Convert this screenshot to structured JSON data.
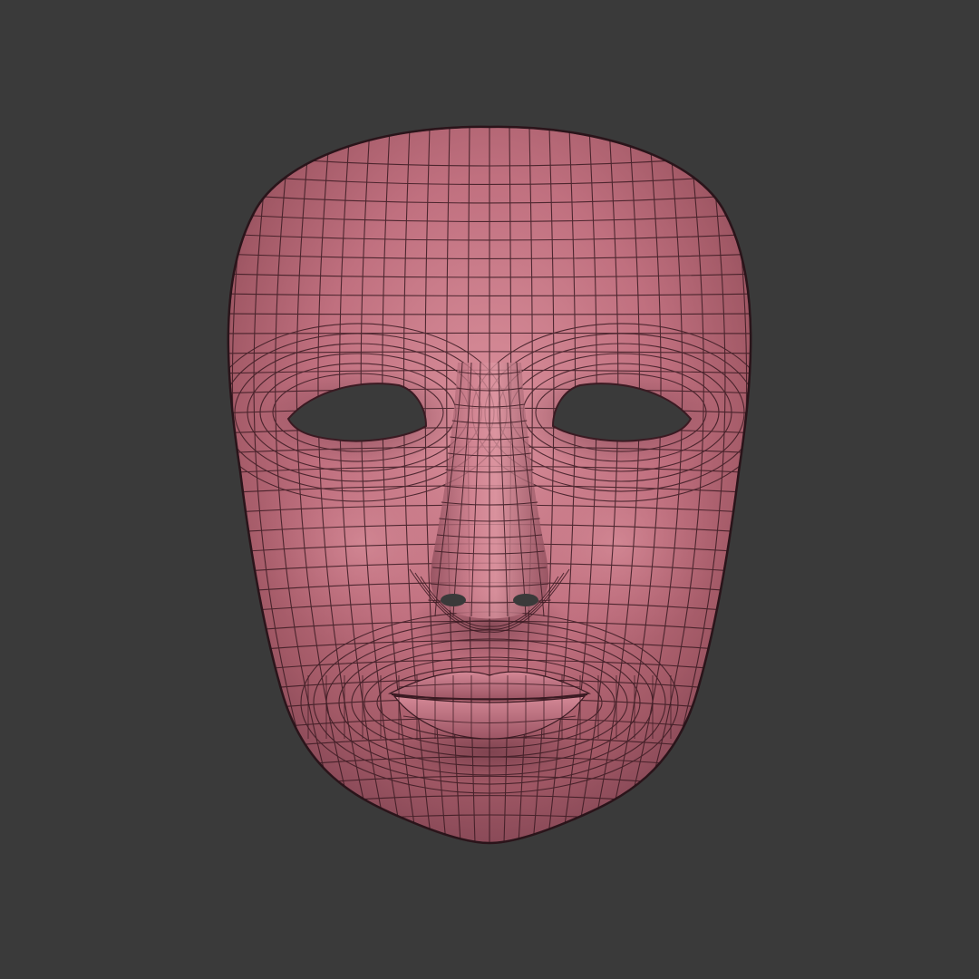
{
  "scene": {
    "background_color": "#3a3a3a",
    "object": "face-mask",
    "render_style": "wireframe-over-shaded",
    "colors": {
      "skin_base": "#c0707f",
      "skin_highlight": "#d98f9b",
      "skin_shadow": "#8a4a58",
      "skin_deep_shadow": "#6e3745",
      "wire": "#3a1a22",
      "hole": "#3a3a3a",
      "lip": "#c57482"
    }
  }
}
